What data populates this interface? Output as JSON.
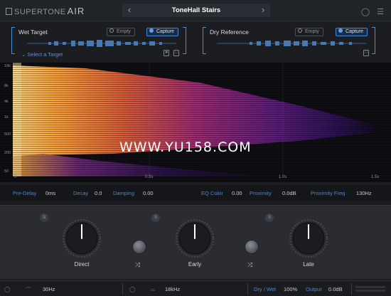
{
  "header": {
    "brand": "SUPERTONE",
    "product": "AIR",
    "preset_name": "ToneHall Stairs",
    "prev_arrow": "‹",
    "next_arrow": "›"
  },
  "wet_target": {
    "title": "Wet Target",
    "empty_label": "Empty",
    "capture_label": "Capture",
    "select_label": "Select a Target"
  },
  "dry_reference": {
    "title": "Dry Reference",
    "empty_label": "Empty",
    "capture_label": "Capture"
  },
  "spectrogram": {
    "freq_labels": [
      "16k",
      "8k",
      "4k",
      "1k",
      "500",
      "200",
      "50"
    ],
    "time_labels": [
      "0",
      "0.5s",
      "1.0s",
      "1.5s"
    ],
    "watermark": "WWW.YU158.COM"
  },
  "params": {
    "pre_delay_label": "Pre-Delay",
    "pre_delay_value": "0ms",
    "decay_label": "Decay",
    "decay_value": "0.0",
    "damping_label": "Damping",
    "damping_value": "0.00",
    "eq_color_label": "EQ Color",
    "eq_color_value": "0.00",
    "proximity_label": "Proximity",
    "proximity_value": "0.0dB",
    "proximity_freq_label": "Proximity Freq",
    "proximity_freq_value": "130Hz"
  },
  "knobs": {
    "direct_label": "Direct",
    "early_label": "Early",
    "late_label": "Late",
    "solo_label": "S",
    "link_symbol": "⤨"
  },
  "footer": {
    "low_freq_value": "30Hz",
    "high_freq_value": "18kHz",
    "dry_wet_label": "Dry / Wet",
    "dry_wet_value": "100%",
    "output_label": "Output",
    "output_value": "0.0dB"
  },
  "colors": {
    "accent": "#4a8fd8",
    "spectrogram_hot": "#ffb347",
    "spectrogram_mid": "#b0307a",
    "spectrogram_cold": "#2a1046"
  }
}
